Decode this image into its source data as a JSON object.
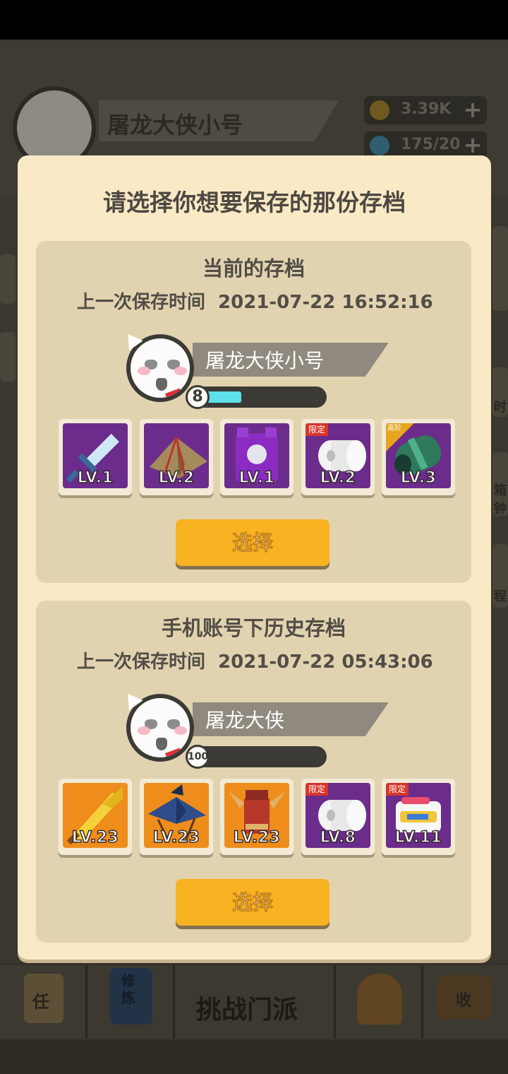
{
  "background": {
    "player_name": "屠龙大侠小号",
    "coins": "3.39K",
    "energy": "175/20",
    "nav_center_label": "挑战门派",
    "side_labels": [
      "时",
      "箱",
      "钟",
      "程"
    ],
    "nav_icons": [
      "任",
      "修炼",
      "收"
    ]
  },
  "dialog": {
    "title": "请选择你想要保存的那份存档",
    "saves": [
      {
        "title": "当前的存档",
        "time_label": "上一次保存时间",
        "time_value": "2021-07-22 16:52:16",
        "player_name": "屠龙大侠小号",
        "level": "8",
        "level_progress": 0.3,
        "items": [
          {
            "name": "sword",
            "level": "LV.1",
            "bg": "purple",
            "tag": ""
          },
          {
            "name": "hat",
            "level": "LV.2",
            "bg": "purple",
            "tag": ""
          },
          {
            "name": "armor",
            "level": "LV.1",
            "bg": "purple",
            "tag": ""
          },
          {
            "name": "toilet-paper",
            "level": "LV.2",
            "bg": "purple",
            "tag": "限定"
          },
          {
            "name": "bracer",
            "level": "LV.3",
            "bg": "purple",
            "tag": "高阶"
          }
        ],
        "button_label": "选择"
      },
      {
        "title": "手机账号下历史存档",
        "time_label": "上一次保存时间",
        "time_value": "2021-07-22 05:43:06",
        "player_name": "屠龙大侠",
        "level": "100",
        "level_progress": 0.0,
        "items": [
          {
            "name": "golden-sword",
            "level": "LV.23",
            "bg": "orange",
            "tag": ""
          },
          {
            "name": "umbrella-hat",
            "level": "LV.23",
            "bg": "orange",
            "tag": ""
          },
          {
            "name": "ninja-armor",
            "level": "LV.23",
            "bg": "orange",
            "tag": ""
          },
          {
            "name": "toilet-paper",
            "level": "LV.8",
            "bg": "purple",
            "tag": "限定"
          },
          {
            "name": "snack-pack",
            "level": "LV.11",
            "bg": "purple",
            "tag": "限定"
          }
        ],
        "button_label": "选择"
      }
    ]
  },
  "colors": {
    "dialog_bg": "#fae9c5",
    "card_bg": "#e2d3b0",
    "button": "#f9b221",
    "level_fill": "#5ee1ea",
    "item_purple": "#6b2c8c",
    "item_orange": "#ee8d1c"
  }
}
